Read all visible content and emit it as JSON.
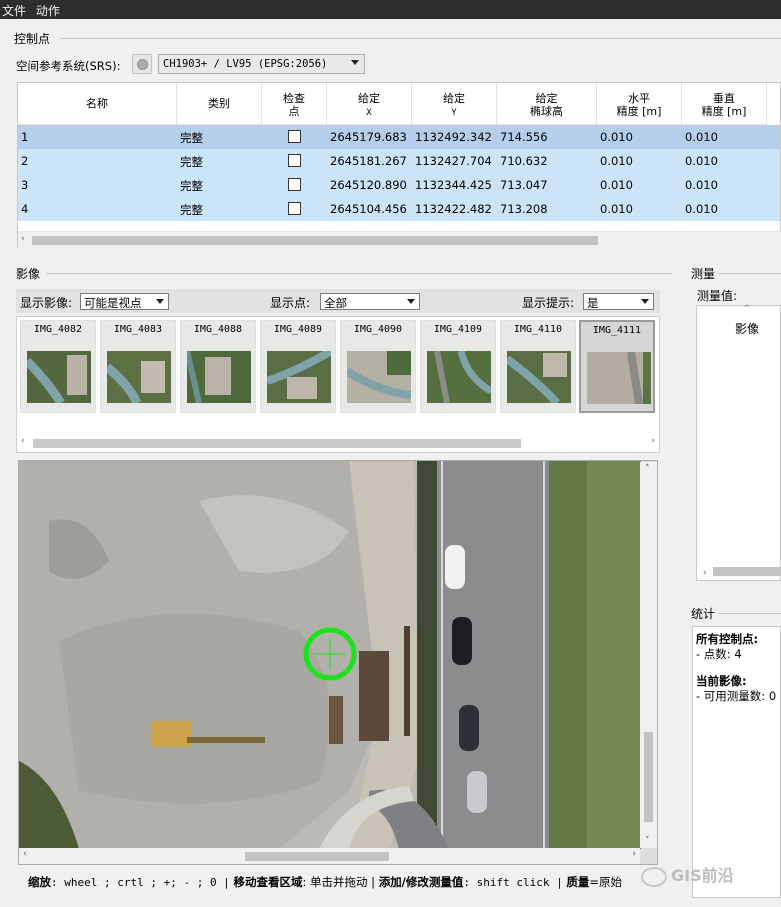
{
  "menu": [
    "文件",
    "动作"
  ],
  "control_points": {
    "title": "控制点",
    "srs_label": "空间参考系统(SRS):",
    "srs_value": "CH1903+ / LV95 (EPSG:2056)",
    "columns": [
      {
        "line1": "名称",
        "line2": ""
      },
      {
        "line1": "类别",
        "line2": ""
      },
      {
        "line1": "检查",
        "line2": "点"
      },
      {
        "line1": "给定",
        "line2": "X"
      },
      {
        "line1": "给定",
        "line2": "Y"
      },
      {
        "line1": "给定",
        "line2": "椭球高"
      },
      {
        "line1": "水平",
        "line2": "精度 [m]"
      },
      {
        "line1": "垂直",
        "line2": "精度 [m]"
      }
    ],
    "rows": [
      {
        "name": "1",
        "type": "完整",
        "check": false,
        "x": "2645179.683",
        "y": "1132492.342",
        "h": "714.556",
        "hacc": "0.010",
        "vacc": "0.010"
      },
      {
        "name": "2",
        "type": "完整",
        "check": false,
        "x": "2645181.267",
        "y": "1132427.704",
        "h": "710.632",
        "hacc": "0.010",
        "vacc": "0.010"
      },
      {
        "name": "3",
        "type": "完整",
        "check": false,
        "x": "2645120.890",
        "y": "1132344.425",
        "h": "713.047",
        "hacc": "0.010",
        "vacc": "0.010"
      },
      {
        "name": "4",
        "type": "完整",
        "check": false,
        "x": "2645104.456",
        "y": "1132422.482",
        "h": "713.208",
        "hacc": "0.010",
        "vacc": "0.010"
      }
    ]
  },
  "images": {
    "title": "影像",
    "show_images_label": "显示影像:",
    "show_images_value": "可能是视点",
    "show_points_label": "显示点:",
    "show_points_value": "全部",
    "show_hints_label": "显示提示:",
    "show_hints_value": "是",
    "thumbnails": [
      "IMG_4082",
      "IMG_4083",
      "IMG_4088",
      "IMG_4089",
      "IMG_4090",
      "IMG_4109",
      "IMG_4110",
      "IMG_4111"
    ],
    "selected_thumbnail": "IMG_4111"
  },
  "measurement": {
    "title": "测量",
    "value_label": "测量值:",
    "column": "影像"
  },
  "stats": {
    "title": "统计",
    "all_points_label": "所有控制点:",
    "points_count": "- 点数: 4",
    "current_image_label": "当前影像:",
    "usable_measurements": "- 可用测量数: 0"
  },
  "statusbar": {
    "zoom_label": "缩放",
    "zoom_keys": ": wheel ; crtl ; +; - ; 0 |",
    "move_label": "移动查看区域",
    "move_keys": ": 单击并拖动 |",
    "add_label": "添加/修改测量值",
    "add_keys": ": shift click |",
    "quality_label": "质量",
    "quality_value": "=原始"
  },
  "watermark": "GIS前沿",
  "colors": {
    "menu_bg": "#2d2d30",
    "row_selected": "#b5cfeb",
    "row_normal": "#cce4f7",
    "marker": "#1fe21f"
  }
}
